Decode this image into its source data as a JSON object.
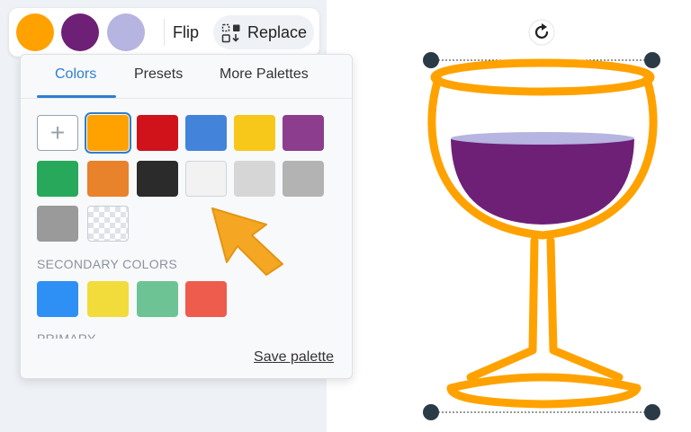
{
  "toolbar": {
    "swatches": [
      {
        "name": "orange",
        "color": "#FFA200"
      },
      {
        "name": "purple",
        "color": "#6E2077"
      },
      {
        "name": "lavender",
        "color": "#B6B4E0"
      }
    ],
    "flip_label": "Flip",
    "replace_label": "Replace"
  },
  "panel": {
    "tabs": [
      {
        "label": "Colors",
        "active": true
      },
      {
        "label": "Presets",
        "active": false
      },
      {
        "label": "More Palettes",
        "active": false
      }
    ],
    "add_symbol": "+",
    "colors": [
      "#FFA200",
      "#D0121B",
      "#4384DA",
      "#F7C719",
      "#8C3D8D",
      "#27A85A",
      "#E8822B",
      "#2B2B2B",
      "#F2F2F2",
      "#D6D6D6",
      "#B3B3B3",
      "#9A9A9A",
      "transparent"
    ],
    "selected_color": "#FFA200",
    "secondary_title": "SECONDARY COLORS",
    "secondary_colors": [
      "#2E8FF5",
      "#F2DC3B",
      "#6EC394",
      "#EE5C4D"
    ],
    "primary_title": "PRIMARY",
    "save_label": "Save palette"
  },
  "canvas": {
    "rotate_icon": "rotate-icon",
    "glass_color": "#FFA200",
    "wine_color": "#6E2077",
    "wine_surface_color": "#B6B4E0"
  }
}
